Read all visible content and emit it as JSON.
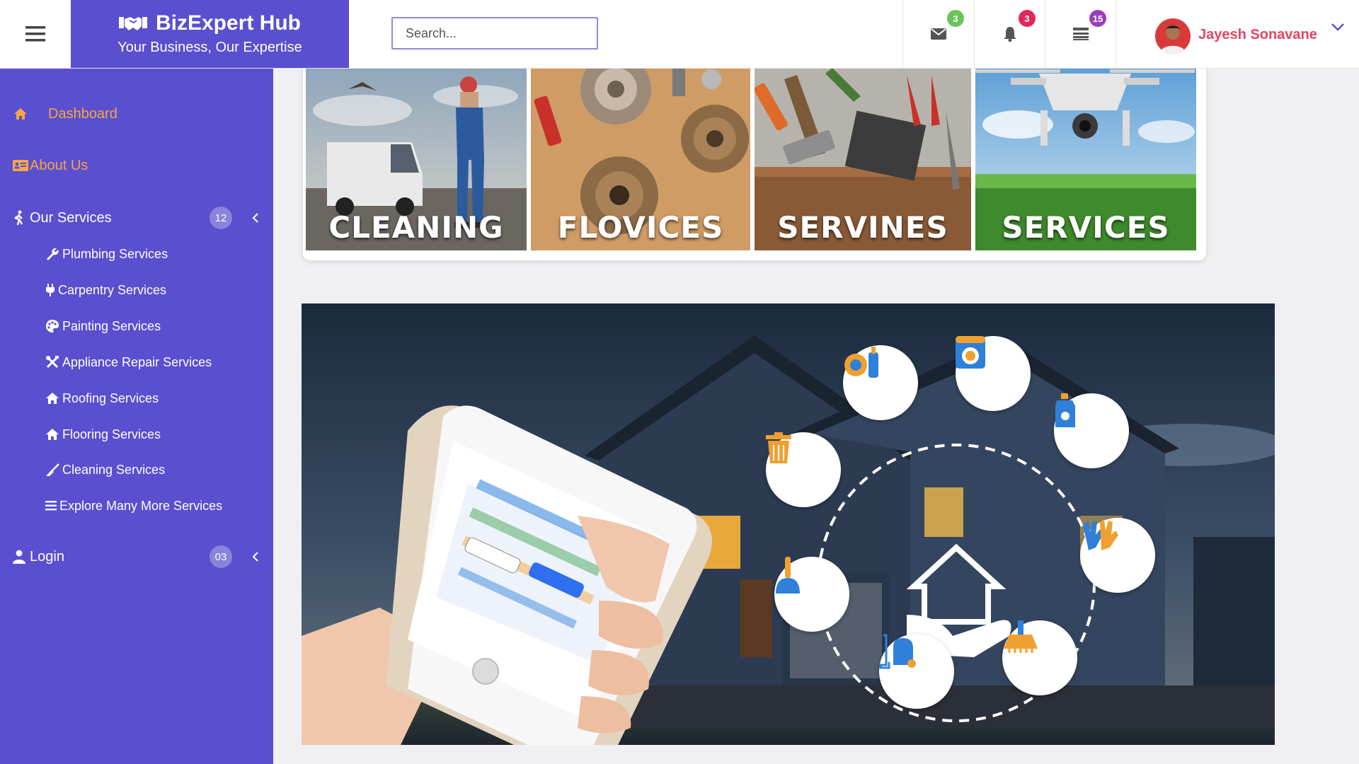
{
  "header": {
    "brand_title": "BizExpert Hub",
    "brand_subtitle": "Your Business, Our Expertise",
    "search_placeholder": "Search...",
    "messages_count": "3",
    "notifications_count": "3",
    "tasks_count": "15",
    "user_name": "Jayesh Sonavane"
  },
  "sidebar": {
    "dashboard": "Dashboard",
    "about": "About Us",
    "services": {
      "label": "Our Services",
      "badge": "12",
      "items": [
        {
          "label": "Plumbing Services",
          "icon": "wrench-icon"
        },
        {
          "label": "Carpentry Services",
          "icon": "plug-icon"
        },
        {
          "label": "Painting Services",
          "icon": "palette-icon"
        },
        {
          "label": "Appliance Repair Services",
          "icon": "tools-icon"
        },
        {
          "label": "Roofing Services",
          "icon": "home-icon"
        },
        {
          "label": "Flooring Services",
          "icon": "home-icon"
        },
        {
          "label": "Cleaning Services",
          "icon": "broom-icon"
        },
        {
          "label": "Explore Many More Services",
          "icon": "list-icon"
        }
      ]
    },
    "login": {
      "label": "Login",
      "badge": "03"
    }
  },
  "tiles": [
    {
      "label": "CLEANING"
    },
    {
      "label": "FLOVICES"
    },
    {
      "label": "SERVINES"
    },
    {
      "label": "SERVICES"
    }
  ],
  "colors": {
    "brand": "#5a4fcf",
    "accent_orange": "#f5a742",
    "user_name": "#e2465f",
    "badge_green": "#6ac259",
    "badge_red": "#e2275b",
    "badge_purple": "#9b3fb8"
  }
}
